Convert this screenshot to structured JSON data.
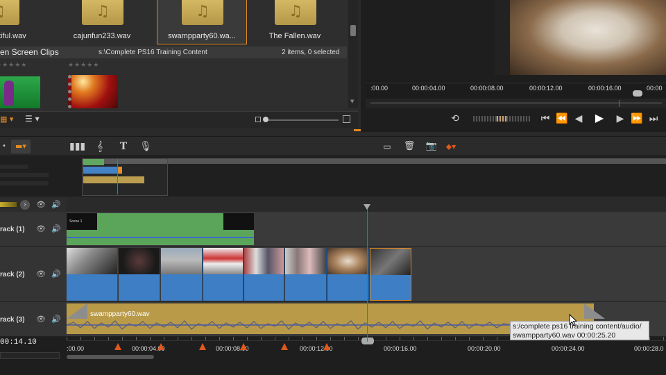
{
  "library": {
    "assets": [
      {
        "name": "tiful.wav"
      },
      {
        "name": "cajunfun233.wav"
      },
      {
        "name": "swampparty60.wa...",
        "selected": true
      },
      {
        "name": "The Fallen.wav"
      }
    ],
    "collection_title": "en Screen Clips",
    "path": "s:\\Complete PS16 Training Content",
    "status": "2 items, 0 selected",
    "stars": "★★★★★"
  },
  "player": {
    "ruler_labels": [
      ":00.00",
      "00:00:04.00",
      "00:00:08.00",
      "00:00:12.00",
      "00:00:16.00",
      "00:00"
    ]
  },
  "timeline": {
    "tracks": [
      {
        "label": "rack (1)"
      },
      {
        "label": "rack (2)"
      },
      {
        "label": "rack (3)"
      }
    ],
    "title_clip_text": "Scene 1",
    "audio_clip_name": "swampparty60.wav",
    "current_time": "00:14.10",
    "ruler_labels": [
      ":00.00",
      "00:00:04.00",
      "00:00:08.00",
      "00:00:12.00",
      "00:00:16.00",
      "00:00:20.00",
      "00:00:24.00",
      "00:00:28.0"
    ]
  },
  "tooltip": {
    "line1": "s:/complete ps16 training content/audio/",
    "line2": "swampparty60.wav  00:00:25.20"
  },
  "colors": {
    "accent": "#e38a1e",
    "playhead": "#e03a2a",
    "video_clip": "#3d7ec4",
    "audio_clip": "#b99a48",
    "title_clip": "#5aa55a"
  }
}
